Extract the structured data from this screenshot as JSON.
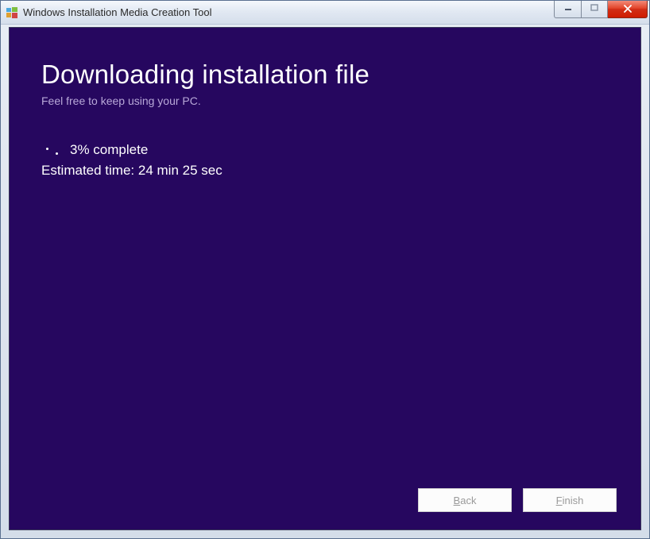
{
  "titlebar": {
    "title": "Windows Installation Media Creation Tool"
  },
  "content": {
    "heading": "Downloading installation file",
    "subheading": "Feel free to keep using your PC.",
    "progress_text": "3% complete",
    "eta_text": "Estimated time: 24 min 25 sec"
  },
  "buttons": {
    "back_prefix": "B",
    "back_rest": "ack",
    "finish_prefix": "F",
    "finish_rest": "inish"
  },
  "colors": {
    "content_bg": "#26075f",
    "close_btn": "#d12f17"
  }
}
